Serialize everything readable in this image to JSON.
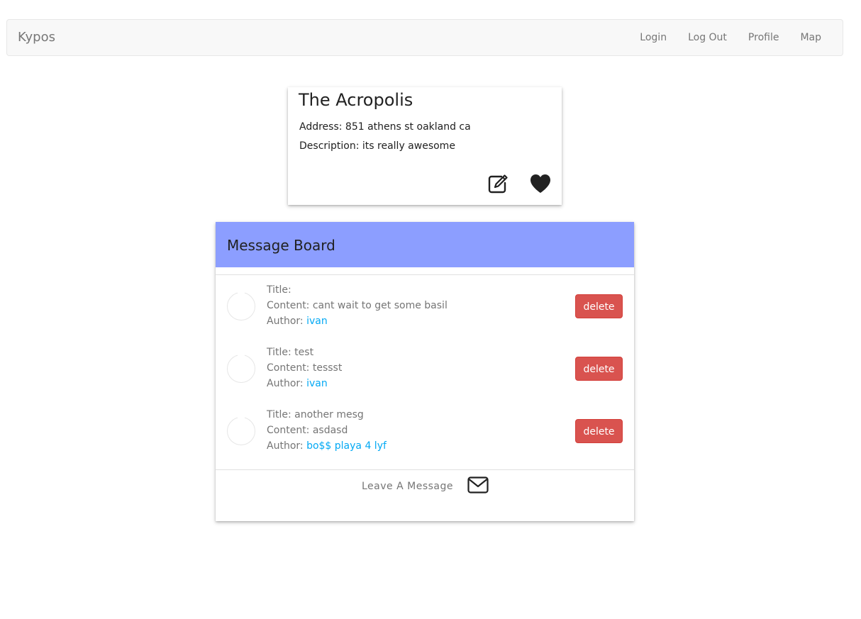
{
  "navbar": {
    "brand": "Kypos",
    "links": [
      "Login",
      "Log Out",
      "Profile",
      "Map"
    ]
  },
  "place": {
    "name": "The Acropolis",
    "address_label": "Address: 851 athens st oakland ca",
    "description_label": "Description: its really awesome",
    "edit_icon": "edit-icon",
    "favorite_icon": "heart-icon"
  },
  "board": {
    "title": "Message Board",
    "messages": [
      {
        "title": "Title:",
        "content": "Content: cant wait to get some basil",
        "author_prefix": "Author: ",
        "author": "ivan",
        "delete_label": "delete"
      },
      {
        "title": "Title: test",
        "content": "Content: tessst",
        "author_prefix": "Author: ",
        "author": "ivan",
        "delete_label": "delete"
      },
      {
        "title": "Title: another mesg",
        "content": "Content: asdasd",
        "author_prefix": "Author: ",
        "author": "bo$$ playa 4 lyf",
        "delete_label": "delete"
      }
    ],
    "leave_message_label": "Leave A Message",
    "mail_icon": "envelope-icon"
  },
  "colors": {
    "header_bg": "#8c9eff",
    "delete_btn": "#d9534f",
    "author_link": "#03a9f4",
    "navbar_bg": "#f8f8f8"
  }
}
